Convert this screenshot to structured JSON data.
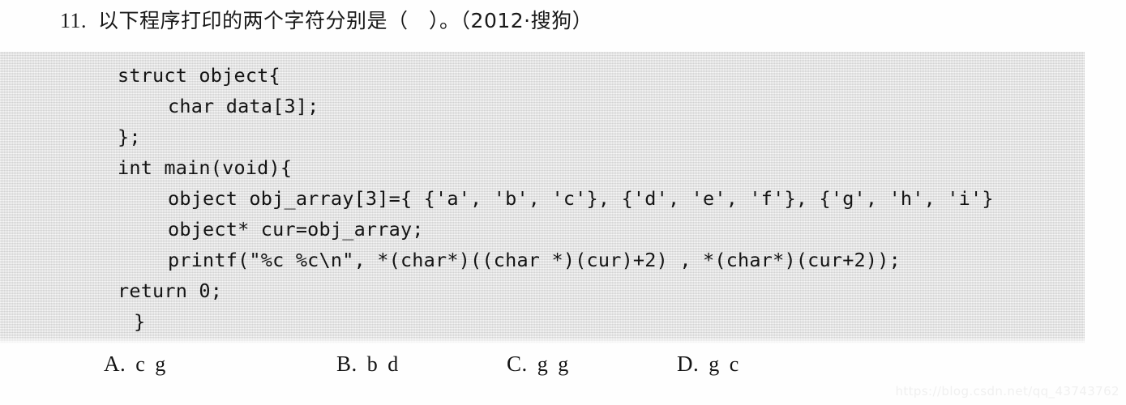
{
  "question": {
    "number": "11.",
    "text": "以下程序打印的两个字符分别是（　）。（2012·搜狗）"
  },
  "code": {
    "lines": [
      {
        "text": "struct object{",
        "indent": 0
      },
      {
        "text": "char data[3];",
        "indent": 1
      },
      {
        "text": "};",
        "indent": 0
      },
      {
        "text": "int main(void){",
        "indent": 0
      },
      {
        "text": "object obj_array[3]={ {'a', 'b', 'c'}, {'d', 'e', 'f'}, {'g', 'h', 'i'}",
        "indent": 1
      },
      {
        "text": "object* cur=obj_array;",
        "indent": 1
      },
      {
        "text": "printf(\"%c %c\\n\", *(char*)((char *)(cur)+2) , *(char*)(cur+2));",
        "indent": 1
      },
      {
        "text": "return 0;",
        "indent": 0
      },
      {
        "text": "}",
        "indent": 2
      }
    ],
    "background_color": "#e6e6e6"
  },
  "options": [
    {
      "letter": "A.",
      "value": "c g"
    },
    {
      "letter": "B.",
      "value": "b d"
    },
    {
      "letter": "C.",
      "value": "g g"
    },
    {
      "letter": "D.",
      "value": "g c"
    }
  ],
  "watermark": "https://blog.csdn.net/qq_43743762"
}
